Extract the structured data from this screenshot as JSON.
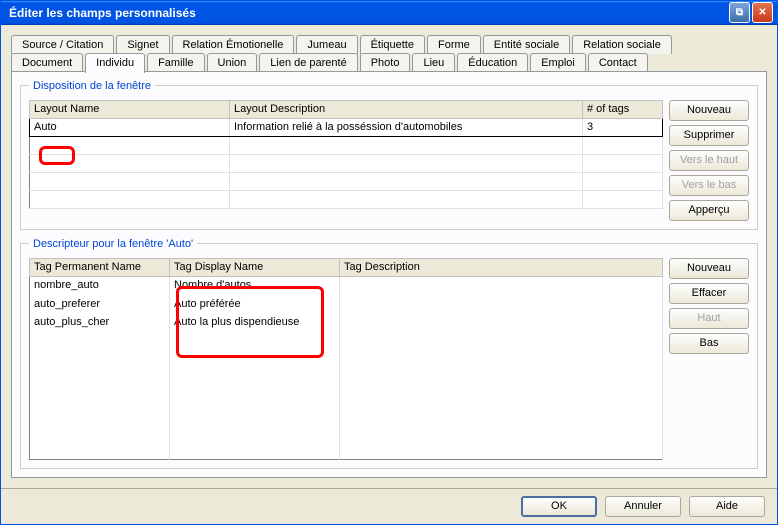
{
  "window": {
    "title": "Éditer les champs personnalisés"
  },
  "tabs_row1": [
    "Source / Citation",
    "Signet",
    "Relation Émotionelle",
    "Jumeau",
    "Étiquette",
    "Forme",
    "Entité sociale",
    "Relation sociale"
  ],
  "tabs_row2": [
    "Document",
    "Individu",
    "Famille",
    "Union",
    "Lien de parenté",
    "Photo",
    "Lieu",
    "Éducation",
    "Emploi",
    "Contact"
  ],
  "active_tab": "Individu",
  "group1": {
    "legend": "Disposition de la fenêtre",
    "headers": [
      "Layout Name",
      "Layout Description",
      "# of tags"
    ],
    "rows": [
      [
        "Auto",
        "Information relié à la posséssion d'automobiles",
        "3"
      ],
      [
        "",
        "",
        ""
      ],
      [
        "",
        "",
        ""
      ],
      [
        "",
        "",
        ""
      ],
      [
        "",
        "",
        ""
      ]
    ],
    "buttons": [
      {
        "label": "Nouveau",
        "enabled": true
      },
      {
        "label": "Supprimer",
        "enabled": true
      },
      {
        "label": "Vers le haut",
        "enabled": false
      },
      {
        "label": "Vers le bas",
        "enabled": false
      },
      {
        "label": "Apperçu",
        "enabled": true
      }
    ]
  },
  "group2": {
    "legend": "Descripteur pour la fenêtre 'Auto'",
    "headers": [
      "Tag Permanent Name",
      "Tag Display Name",
      "Tag Description"
    ],
    "rows": [
      [
        "nombre_auto",
        "Nombre d'autos",
        ""
      ],
      [
        "auto_preferer",
        "Auto préférée",
        ""
      ],
      [
        "auto_plus_cher",
        "Auto la plus dispendieuse",
        ""
      ],
      [
        "",
        "",
        ""
      ],
      [
        "",
        "",
        ""
      ],
      [
        "",
        "",
        ""
      ],
      [
        "",
        "",
        ""
      ],
      [
        "",
        "",
        ""
      ],
      [
        "",
        "",
        ""
      ],
      [
        "",
        "",
        ""
      ]
    ],
    "buttons": [
      {
        "label": "Nouveau",
        "enabled": true
      },
      {
        "label": "Effacer",
        "enabled": true
      },
      {
        "label": "Haut",
        "enabled": false
      },
      {
        "label": "Bas",
        "enabled": true
      }
    ]
  },
  "bottom": {
    "ok": "OK",
    "cancel": "Annuler",
    "help": "Aide"
  }
}
